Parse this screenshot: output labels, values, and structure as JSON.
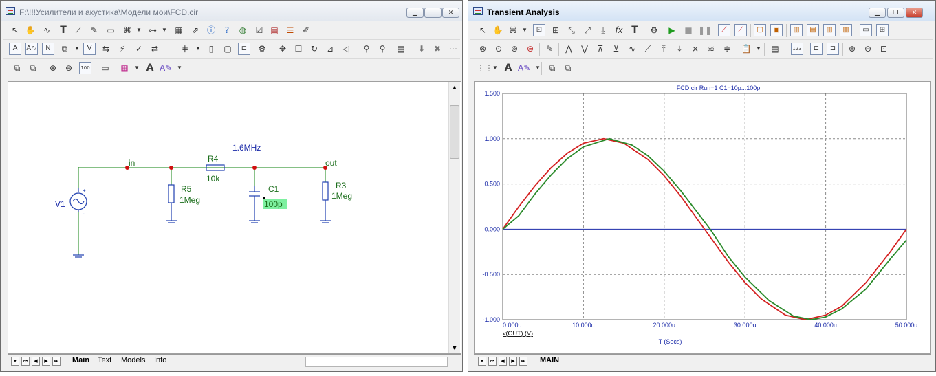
{
  "left_window": {
    "title": "F:\\!!!Усилители и акустика\\Модели мои\\FCD.cir",
    "tabs": [
      {
        "label": "Main",
        "active": true
      },
      {
        "label": "Text",
        "active": false
      },
      {
        "label": "Models",
        "active": false
      },
      {
        "label": "Info",
        "active": false
      }
    ],
    "schematic": {
      "components": {
        "v1": {
          "label": "V1"
        },
        "r5": {
          "label": "R5",
          "value": "1Meg"
        },
        "r4": {
          "label": "R4",
          "value": "10k"
        },
        "c1": {
          "label": "C1",
          "value": "100p"
        },
        "r3": {
          "label": "R3",
          "value": "1Meg"
        }
      },
      "nodes": {
        "in": "in",
        "out": "out"
      },
      "annotation": "1.6MHz",
      "colors": {
        "wire": "#3c9a3c",
        "component": "#2040b0",
        "node_dot": "#d01010",
        "highlight": "#7ef0a0",
        "text_blue": "#1a2aa8",
        "text_green": "#1c6e1c"
      }
    }
  },
  "right_window": {
    "title": "Transient Analysis",
    "tabs": [
      {
        "label": "MAIN",
        "active": true
      }
    ]
  },
  "icons": {
    "left_row1": [
      "pointer-icon",
      "hand-icon",
      "wire-icon",
      "text-icon",
      "probe-icon",
      "pencil-icon",
      "part-icon",
      "component-icon",
      "dropdown-icon",
      "tree-icon",
      "dropdown-icon",
      "grid-icon",
      "link-icon",
      "info-icon",
      "help-icon",
      "globe-icon",
      "check-icon",
      "doc-icon",
      "list-icon",
      "edit-icon"
    ],
    "right_row1": [
      "pointer-icon",
      "hand-icon",
      "dropdown-icon",
      "zoom-box-icon",
      "zoom-region-icon",
      "scale-icon",
      "scale-icon",
      "scale-icon",
      "fx-icon",
      "text-icon",
      "settings-icon",
      "play-icon",
      "stop-icon",
      "pause-icon",
      "cursor-icon",
      "cursor-icon",
      "box-icon",
      "box-icon",
      "view-icon",
      "view-icon",
      "view-icon",
      "view-icon",
      "split-icon",
      "split-icon"
    ]
  },
  "chart_data": {
    "type": "line",
    "title": "FCD.cir Run=1 C1=10p...100p",
    "xlabel": "T (Secs)",
    "ylabel": "",
    "legend_label": "v(OUT) (V)",
    "x_units": "us",
    "xlim": [
      0,
      50
    ],
    "ylim": [
      -1.0,
      1.5
    ],
    "x_ticks": [
      0,
      10,
      20,
      30,
      40,
      50
    ],
    "x_tick_labels": [
      "0.000u",
      "10.000u",
      "20.000u",
      "30.000u",
      "40.000u",
      "50.000u"
    ],
    "y_ticks": [
      -1.0,
      -0.5,
      0.0,
      0.5,
      1.0,
      1.5
    ],
    "y_tick_labels": [
      "-1.000",
      "-0.500",
      "0.000",
      "0.500",
      "1.000",
      "1.500"
    ],
    "grid": true,
    "series": [
      {
        "color": "#d42020",
        "x": [
          0,
          2,
          4,
          6,
          8,
          10,
          12.5,
          15,
          18,
          20,
          22,
          25,
          28,
          30,
          32,
          35,
          37.5,
          40,
          42,
          45,
          48,
          50
        ],
        "y": [
          0,
          0.25,
          0.48,
          0.68,
          0.84,
          0.95,
          1.0,
          0.95,
          0.77,
          0.59,
          0.37,
          0.0,
          -0.37,
          -0.59,
          -0.77,
          -0.95,
          -1.0,
          -0.95,
          -0.85,
          -0.59,
          -0.25,
          0.0
        ]
      },
      {
        "color": "#2a8a2a",
        "x": [
          0,
          2,
          4,
          6,
          8,
          10,
          13.2,
          16,
          18,
          20,
          22,
          25.7,
          28,
          30,
          33,
          36,
          38.2,
          40,
          42,
          45,
          48,
          50
        ],
        "y": [
          0,
          0.15,
          0.39,
          0.6,
          0.78,
          0.91,
          1.0,
          0.93,
          0.81,
          0.64,
          0.43,
          0.0,
          -0.31,
          -0.53,
          -0.79,
          -0.96,
          -1.0,
          -0.97,
          -0.88,
          -0.66,
          -0.33,
          -0.12
        ]
      }
    ]
  }
}
